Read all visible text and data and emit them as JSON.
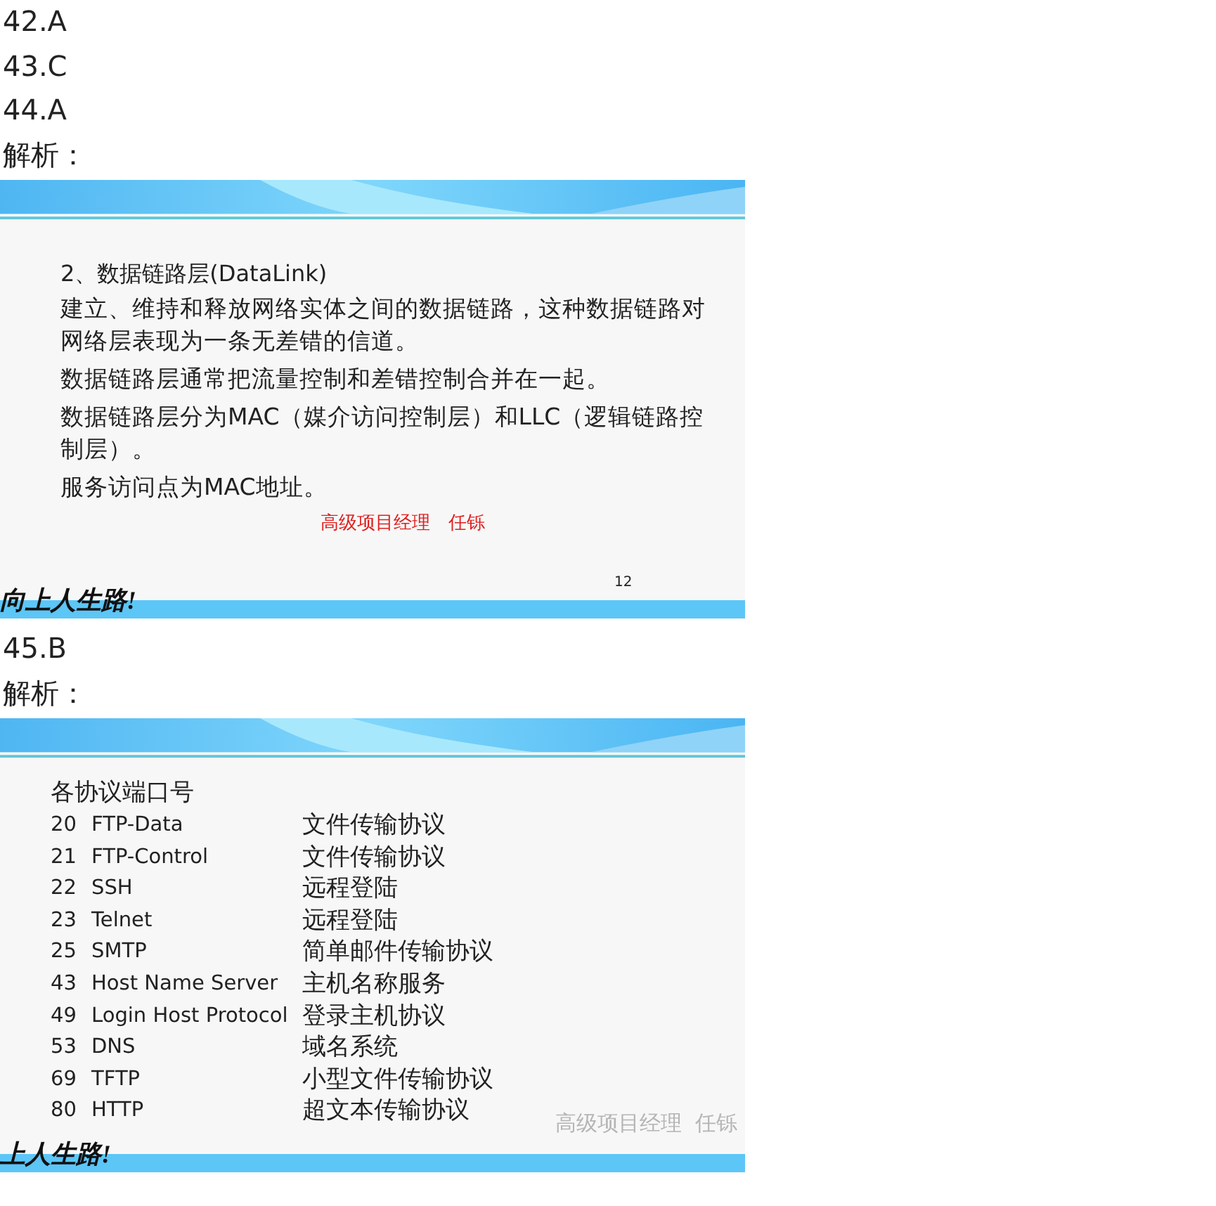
{
  "blocks": [
    {
      "kind": "answer",
      "text": "42.A"
    },
    {
      "kind": "answer",
      "text": "43.C"
    },
    {
      "kind": "answer",
      "text": "44.A"
    },
    {
      "kind": "label",
      "text": "解析："
    },
    {
      "kind": "text_slide",
      "title": "2、数据链路层(DataLink)",
      "paragraphs": [
        "建立、维持和释放网络实体之间的数据链路，这种数据链路对网络层表现为一条无差错的信道。",
        "数据链路层通常把流量控制和差错控制合并在一起。",
        "数据链路层分为MAC（媒介访问控制层）和LLC（逻辑链路控制层）。",
        "服务访问点为MAC地址。"
      ],
      "signature": "高级项目经理　任铄",
      "page_number": "12",
      "slogan": "向上人生路!"
    },
    {
      "kind": "answer",
      "text": "45.B"
    },
    {
      "kind": "label",
      "text": "解析："
    },
    {
      "kind": "port_slide",
      "title": "各协议端口号",
      "rows": [
        {
          "port": "20",
          "name": "FTP-Data",
          "desc": "文件传输协议"
        },
        {
          "port": "21",
          "name": "FTP-Control",
          "desc": "文件传输协议"
        },
        {
          "port": "22",
          "name": "SSH",
          "desc": "远程登陆"
        },
        {
          "port": "23",
          "name": "Telnet",
          "desc": "远程登陆"
        },
        {
          "port": "25",
          "name": "SMTP",
          "desc": "简单邮件传输协议"
        },
        {
          "port": "43",
          "name": "Host Name Server",
          "desc": "主机名称服务"
        },
        {
          "port": "49",
          "name": "Login Host Protocol",
          "desc": "登录主机协议"
        },
        {
          "port": "53",
          "name": "DNS",
          "desc": "域名系统"
        },
        {
          "port": "69",
          "name": "TFTP",
          "desc": "小型文件传输协议"
        },
        {
          "port": "80",
          "name": "HTTP",
          "desc": "超文本传输协议"
        }
      ],
      "signature": "高级项目经理  任铄",
      "slogan": "上人生路!"
    }
  ]
}
